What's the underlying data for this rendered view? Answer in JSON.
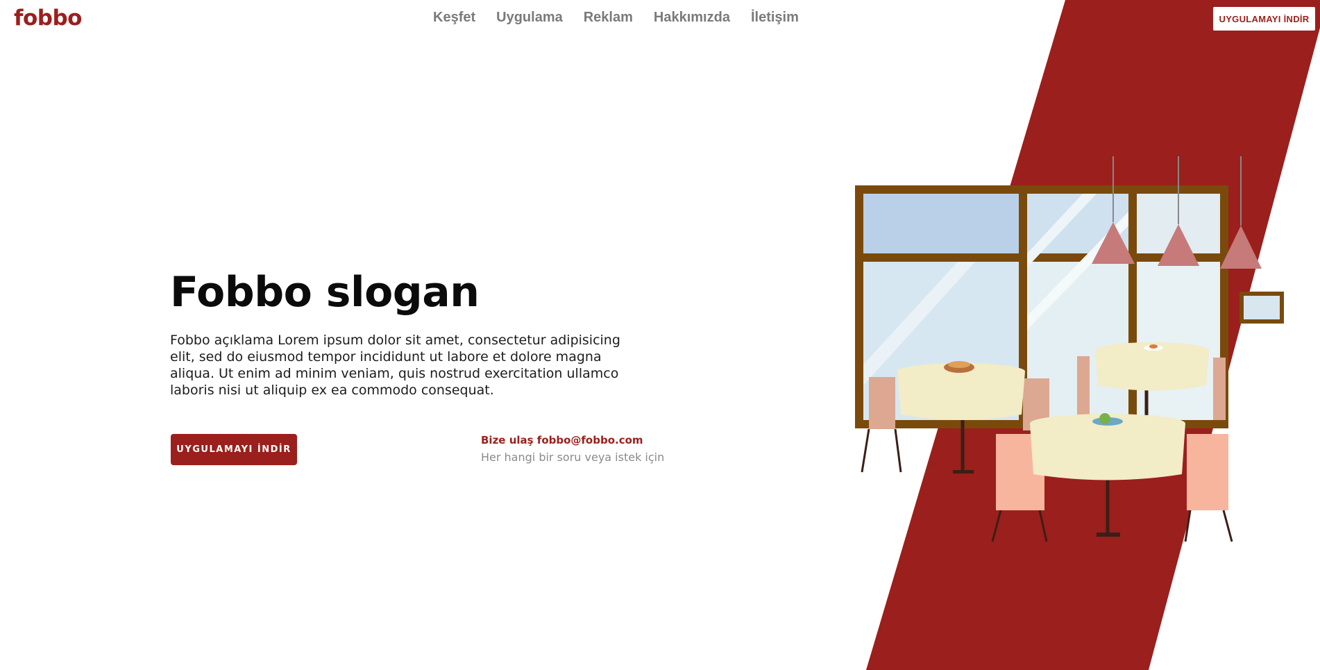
{
  "brand": {
    "name": "fobbo"
  },
  "nav": {
    "items": [
      {
        "label": "Keşfet"
      },
      {
        "label": "Uygulama"
      },
      {
        "label": "Reklam"
      },
      {
        "label": "Hakkımızda"
      },
      {
        "label": "İletişim"
      }
    ],
    "download_label": "UYGULAMAYI İNDİR"
  },
  "hero": {
    "title": "Fobbo slogan",
    "description": "Fobbo açıklama Lorem ipsum dolor sit amet, consectetur adipisicing elit, sed do eiusmod tempor incididunt ut labore et dolore magna aliqua. Ut enim ad minim veniam, quis nostrud exercitation ullamco laboris nisi ut aliquip ex ea commodo consequat.",
    "cta_label": "UYGULAMAYI İNDİR"
  },
  "contact": {
    "line": "Bize ulaş fobbo@fobbo.com",
    "sub": "Her hangi bir soru veya istek için"
  },
  "colors": {
    "brand_red": "#9b1f1c",
    "nav_gray": "#7a7a7a",
    "window_frame": "#7a4a0c",
    "tablecloth": "#f2ecc7",
    "chair": "#f7b59e",
    "lamp": "#c67a7a"
  },
  "illustration": {
    "icon": "restaurant-illustration"
  }
}
